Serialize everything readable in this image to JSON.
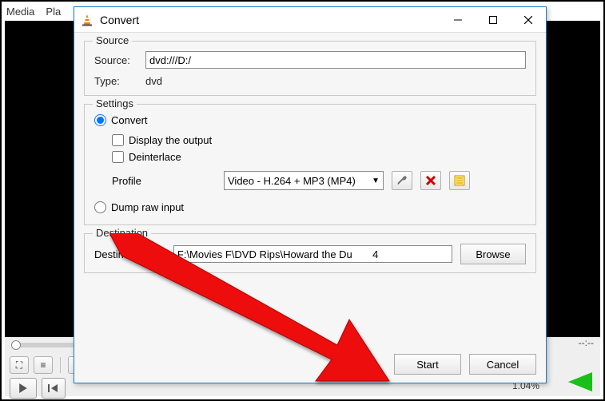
{
  "main_window": {
    "menubar": [
      "Media",
      "Pla"
    ],
    "time_right": "--:--",
    "volume_label": "1.04%"
  },
  "dialog": {
    "title": "Convert",
    "source_group": {
      "legend": "Source",
      "source_label": "Source:",
      "source_value": "dvd:///D:/",
      "type_label": "Type:",
      "type_value": "dvd"
    },
    "settings_group": {
      "legend": "Settings",
      "convert_label": "Convert",
      "display_output_label": "Display the output",
      "deinterlace_label": "Deinterlace",
      "profile_label": "Profile",
      "profile_value": "Video - H.264 + MP3 (MP4)",
      "dump_raw_label": "Dump raw input"
    },
    "destination_group": {
      "legend": "Destination",
      "dest_label": "Destination file:",
      "dest_value": "F:\\Movies F\\DVD Rips\\Howard the Du       4",
      "browse_label": "Browse"
    },
    "footer": {
      "start": "Start",
      "cancel": "Cancel"
    }
  }
}
